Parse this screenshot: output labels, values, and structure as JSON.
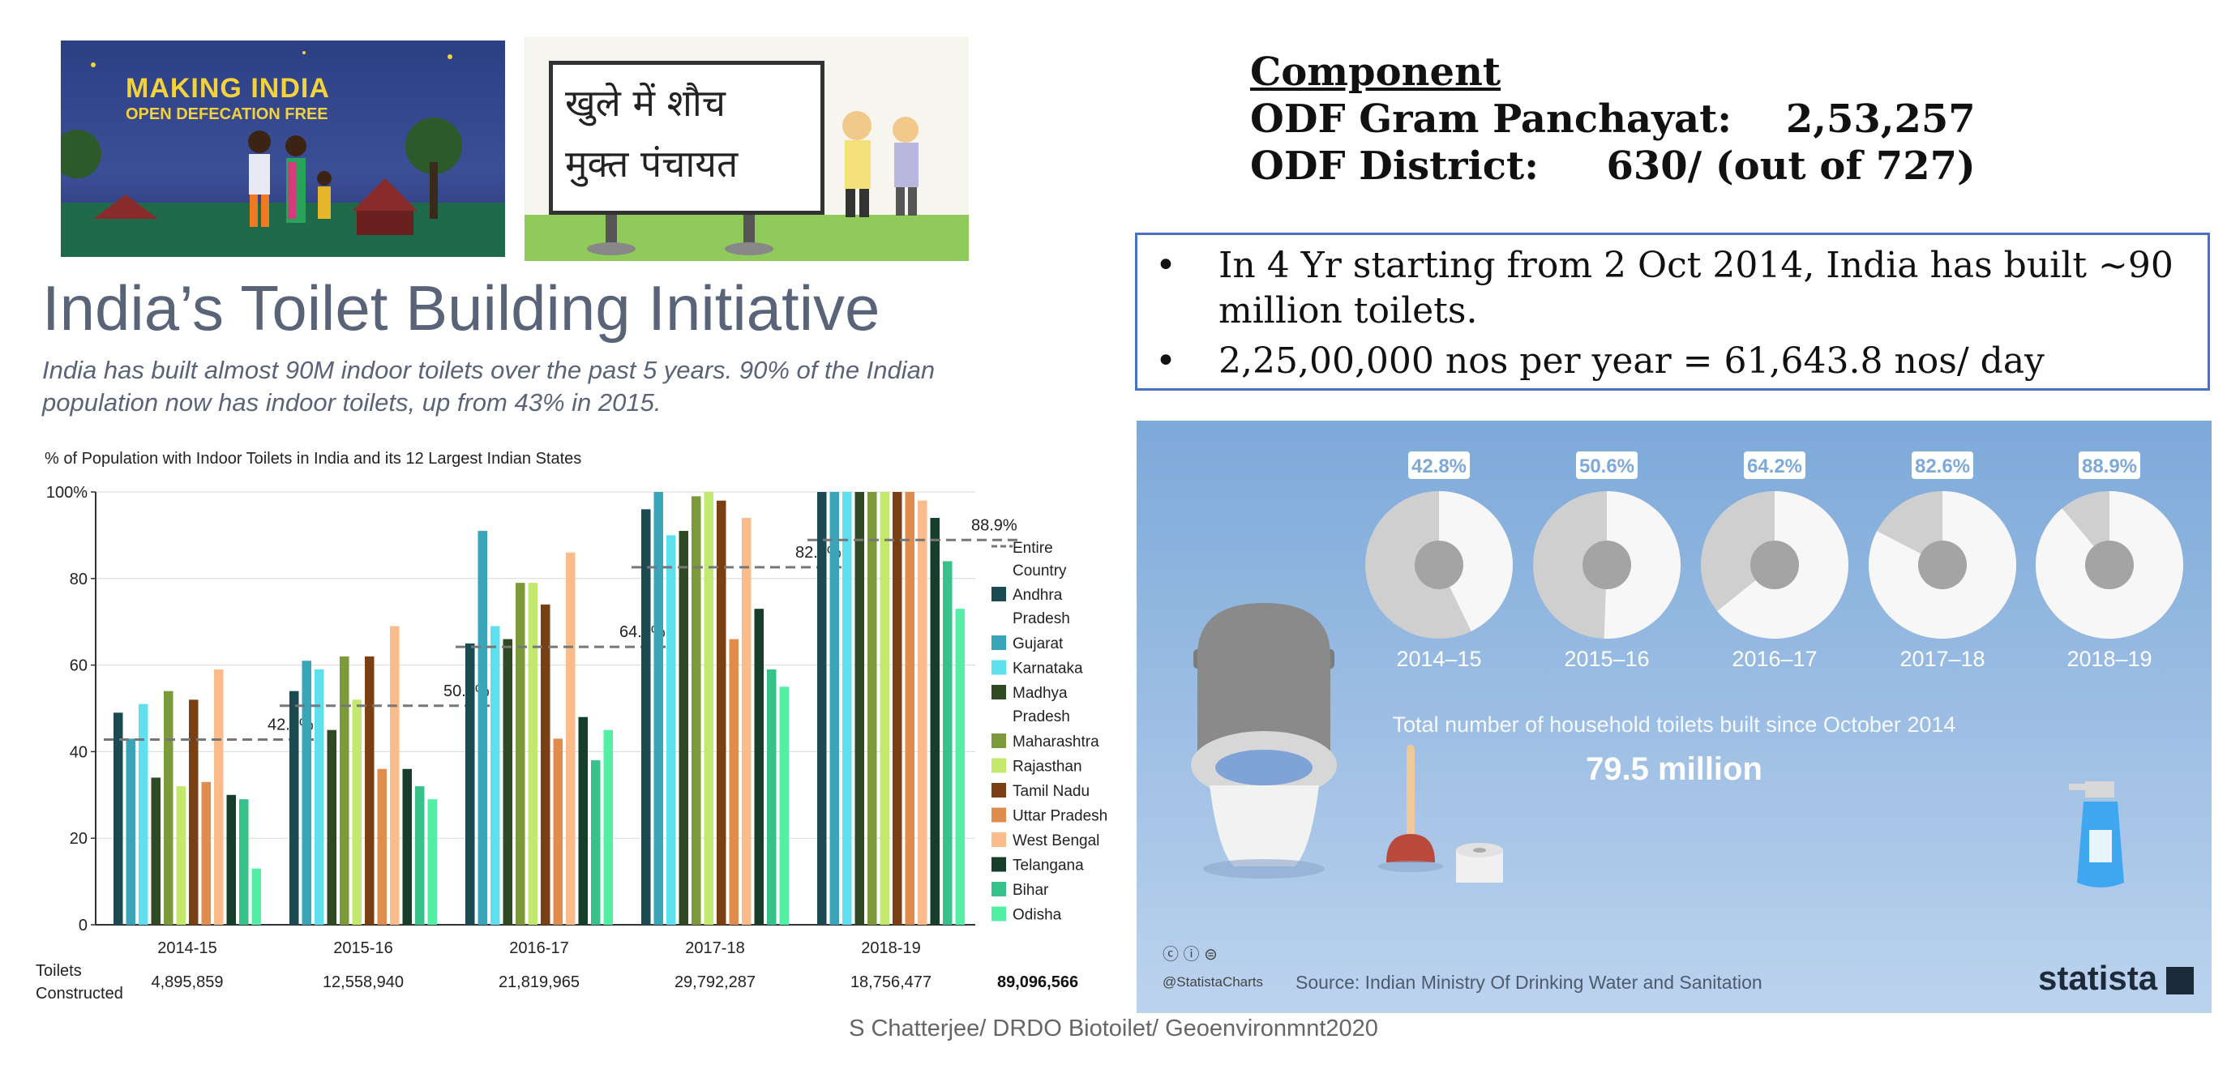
{
  "poster1": {
    "line1": "MAKING INDIA",
    "line2": "OPEN DEFECATION FREE"
  },
  "poster2": {
    "line1": "खुले में शौच",
    "line2": "मुक्त पंचायत"
  },
  "main_title": "India’s Toilet Building Initiative",
  "subtitle": "India has built almost 90M indoor toilets over the past 5 years. 90% of the Indian population now has indoor toilets, up from 43% in 2015.",
  "component": {
    "heading": "Component",
    "line1": "ODF Gram Panchayat:    2,53,257",
    "line2": "ODF District:     630/ (out of 727)"
  },
  "bullets": [
    "In 4 Yr starting from 2 Oct 2014, India has built ~90 million toilets.",
    "2,25,00,000 nos per year = 61,643.8 nos/ day"
  ],
  "footer": "S Chatterjee/ DRDO Biotoilet/ Geoenvironmnt2020",
  "chart_data": [
    {
      "type": "bar",
      "title": "% of Population with Indoor Toilets in India and its 12 Largest Indian States",
      "categories": [
        "2014-15",
        "2015-16",
        "2016-17",
        "2017-18",
        "2018-19"
      ],
      "ylim": [
        0,
        100
      ],
      "yticks": [
        "0",
        "20",
        "40",
        "60",
        "80",
        "100%"
      ],
      "series": [
        {
          "name": "Andhra Pradesh",
          "color": "#1b4a52",
          "values": [
            49,
            54,
            65,
            96,
            100
          ]
        },
        {
          "name": "Gujarat",
          "color": "#3aa4b8",
          "values": [
            43,
            61,
            91,
            100,
            100
          ]
        },
        {
          "name": "Karnataka",
          "color": "#5fe0ef",
          "values": [
            51,
            59,
            69,
            90,
            100
          ]
        },
        {
          "name": "Madhya Pradesh",
          "color": "#2f4a22",
          "values": [
            34,
            45,
            66,
            91,
            100
          ]
        },
        {
          "name": "Maharashtra",
          "color": "#7c9a39",
          "values": [
            54,
            62,
            79,
            99,
            100
          ]
        },
        {
          "name": "Rajasthan",
          "color": "#c2e86e",
          "values": [
            32,
            52,
            79,
            100,
            100
          ]
        },
        {
          "name": "Tamil Nadu",
          "color": "#7a3f12",
          "values": [
            52,
            62,
            74,
            98,
            100
          ]
        },
        {
          "name": "Uttar Pradesh",
          "color": "#df8c4c",
          "values": [
            33,
            36,
            43,
            66,
            100
          ]
        },
        {
          "name": "West Bengal",
          "color": "#fcbb8a",
          "values": [
            59,
            69,
            86,
            94,
            98
          ]
        },
        {
          "name": "Telangana",
          "color": "#163e2a",
          "values": [
            30,
            36,
            48,
            73,
            94
          ]
        },
        {
          "name": "Bihar",
          "color": "#36c289",
          "values": [
            29,
            32,
            38,
            59,
            84
          ]
        },
        {
          "name": "Odisha",
          "color": "#52f0a5",
          "values": [
            13,
            29,
            45,
            55,
            73
          ]
        }
      ],
      "entire_country": {
        "name": "Entire Country",
        "values": [
          42.8,
          50.6,
          64.2,
          82.6,
          88.9
        ],
        "labels": [
          "42.8%",
          "50.6%",
          "64.2%",
          "82.6%",
          "88.9%"
        ]
      },
      "toilets_label": "Toilets Constructed",
      "toilets_constructed": [
        "4,895,859",
        "12,558,940",
        "21,819,965",
        "29,792,287",
        "18,756,477"
      ],
      "toilets_total": "89,096,566"
    },
    {
      "type": "pie",
      "categories": [
        "2014–15",
        "2015–16",
        "2016–17",
        "2017–18",
        "2018–19"
      ],
      "values": [
        42.8,
        50.6,
        64.2,
        82.6,
        88.9
      ],
      "labels": [
        "42.8%",
        "50.6%",
        "64.2%",
        "82.6%",
        "88.9%"
      ],
      "caption": "Total number of household toilets built since October 2014",
      "total": "79.5 million",
      "source": "Source: Indian Ministry Of Drinking Water and Sanitation",
      "handle": "@StatistaCharts",
      "brand": "statista"
    }
  ]
}
